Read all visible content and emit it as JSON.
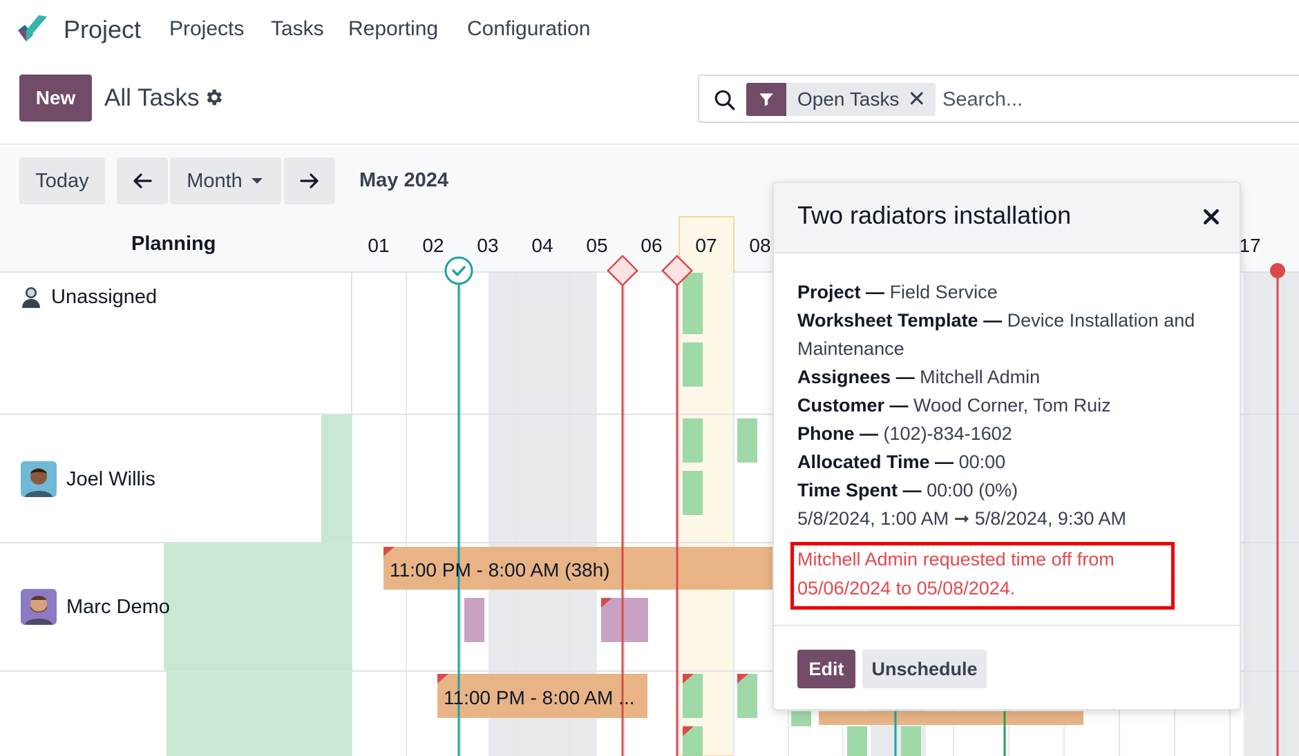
{
  "app": {
    "title": "Project",
    "menu": [
      "Projects",
      "Tasks",
      "Reporting",
      "Configuration"
    ]
  },
  "control": {
    "new_label": "New",
    "breadcrumb": "All Tasks",
    "facet": "Open Tasks",
    "search_placeholder": "Search..."
  },
  "gantt": {
    "today": "Today",
    "scale": "Month",
    "period": "May 2024",
    "planning_header": "Planning",
    "days": [
      "01",
      "02",
      "03",
      "04",
      "05",
      "06",
      "07",
      "08",
      "17"
    ],
    "rows": [
      "Unassigned",
      "Joel Willis",
      "Marc Demo"
    ],
    "pills": {
      "marc_demo": "11:00 PM - 8:00 AM (38h)",
      "row4": "11:00 PM - 8:00 AM ..."
    }
  },
  "popover": {
    "title": "Two radiators installation",
    "fields": [
      {
        "label": "Project —",
        "value": "Field Service"
      },
      {
        "label": "Worksheet Template —",
        "value": "Device Installation and Maintenance"
      },
      {
        "label": "Assignees —",
        "value": "Mitchell Admin"
      },
      {
        "label": "Customer —",
        "value": "Wood Corner, Tom Ruiz"
      },
      {
        "label": "Phone —",
        "value": "(102)-834-1602"
      },
      {
        "label": "Allocated Time —",
        "value": "00:00"
      },
      {
        "label": "Time Spent —",
        "value": "00:00 (0%)"
      }
    ],
    "dates": "5/8/2024, 1:00 AM ➞ 5/8/2024, 9:30 AM",
    "warning": "Mitchell Admin requested time off from 05/06/2024 to 05/08/2024.",
    "edit_label": "Edit",
    "unschedule_label": "Unschedule"
  },
  "colors": {
    "brand": "#714b67",
    "pill_orange": "#e8b486",
    "pill_green": "#9fd9a7",
    "pill_purple": "#c9a1c3",
    "availability_green": "#c8e8d2",
    "weekend_gray": "#e8eaed",
    "deadline_red": "#d94b4b",
    "milestone_teal": "#1aa3a3",
    "warning_red": "#e5484d"
  }
}
